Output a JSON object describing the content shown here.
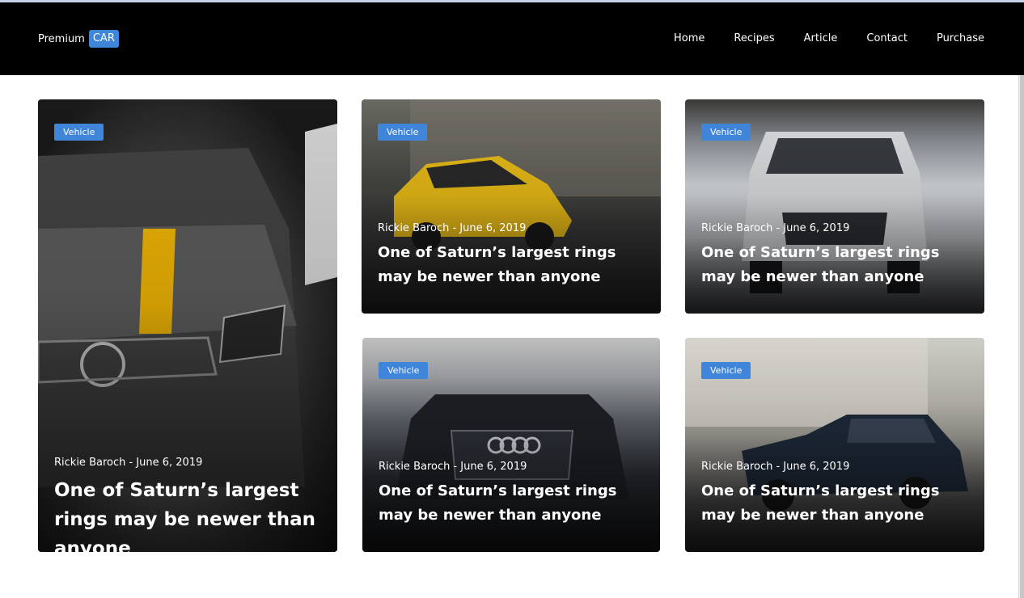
{
  "header": {
    "brand_text": "Premium",
    "brand_badge": "CAR",
    "nav": [
      "Home",
      "Recipes",
      "Article",
      "Contact",
      "Purchase"
    ]
  },
  "cards": [
    {
      "tag": "Vehicle",
      "meta": "Rickie Baroch - June 6, 2019",
      "title": "One of Saturn’s largest rings may be newer than anyone"
    },
    {
      "tag": "Vehicle",
      "meta": "Rickie Baroch - June 6, 2019",
      "title": "One of Saturn’s largest rings may be newer than anyone"
    },
    {
      "tag": "Vehicle",
      "meta": "Rickie Baroch - June 6, 2019",
      "title": "One of Saturn’s largest rings may be newer than anyone"
    },
    {
      "tag": "Vehicle",
      "meta": "Rickie Baroch - June 6, 2019",
      "title": "One of Saturn’s largest rings may be newer than anyone"
    },
    {
      "tag": "Vehicle",
      "meta": "Rickie Baroch - June 6, 2019",
      "title": "One of Saturn’s largest rings may be newer than anyone"
    }
  ],
  "colors": {
    "navbar": "#000000",
    "accent": "#3f86db",
    "background": "#ffffff"
  }
}
